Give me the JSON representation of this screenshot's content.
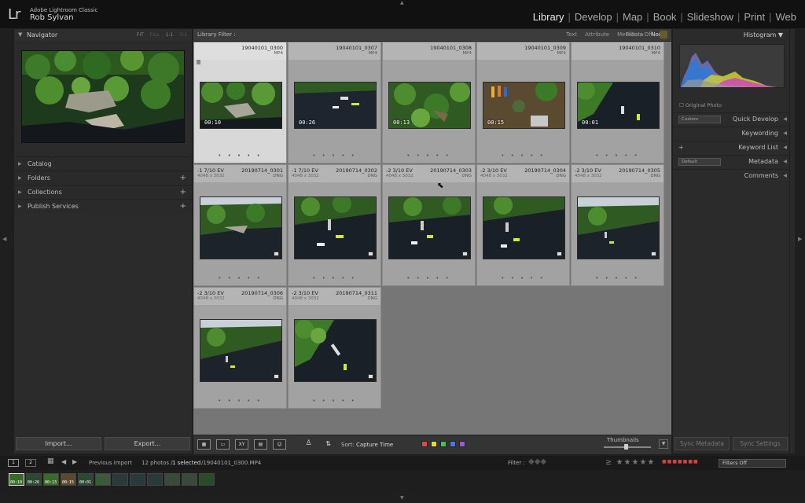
{
  "app": {
    "logo": "Lr",
    "name": "Adobe Lightroom Classic",
    "user": "Rob Sylvan"
  },
  "modules": [
    "Library",
    "Develop",
    "Map",
    "Book",
    "Slideshow",
    "Print",
    "Web"
  ],
  "left_panel": {
    "navigator_title": "Navigator",
    "zoom_fit": "FIT",
    "zoom_fill": "FILL",
    "zoom_1": "1:1",
    "zoom_3": "3:1",
    "sections": [
      "Catalog",
      "Folders",
      "Collections",
      "Publish Services"
    ],
    "import_label": "Import...",
    "export_label": "Export..."
  },
  "filter_bar": {
    "title": "Library Filter :",
    "tabs": [
      "Text",
      "Attribute",
      "Metadata",
      "None"
    ],
    "filters_off": "Filters Off"
  },
  "grid": [
    {
      "name": "19040101_0300",
      "ext": "MP4",
      "duration": "00:10",
      "selected": true
    },
    {
      "name": "19040101_0307",
      "ext": "MP4",
      "duration": "00:26"
    },
    {
      "name": "19040101_0308",
      "ext": "MP4",
      "duration": "00:13"
    },
    {
      "name": "19040101_0309",
      "ext": "MP4",
      "duration": "00:15"
    },
    {
      "name": "19040101_0310",
      "ext": "MP4",
      "duration": "00:01"
    },
    {
      "ev": "-1 7/10 EV",
      "name": "20190714_0301",
      "dims": "4048 x 3032",
      "ext": "DNG"
    },
    {
      "ev": "-1 7/10 EV",
      "name": "20190714_0302",
      "dims": "4048 x 3032",
      "ext": "DNG"
    },
    {
      "ev": "-2 3/10 EV",
      "name": "20190714_0303",
      "dims": "4048 x 3032",
      "ext": "DNG"
    },
    {
      "ev": "-2 3/10 EV",
      "name": "20190714_0304",
      "dims": "4048 x 3032",
      "ext": "DNG"
    },
    {
      "ev": "-2 3/10 EV",
      "name": "20190714_0305",
      "dims": "4048 x 3032",
      "ext": "DNG"
    },
    {
      "ev": "-2 3/10 EV",
      "name": "20190714_0306",
      "dims": "4048 x 3032",
      "ext": "DNG"
    },
    {
      "ev": "-2 3/10 EV",
      "name": "20190714_0311",
      "dims": "4048 x 3032",
      "ext": "DNG"
    }
  ],
  "toolbar": {
    "sort_label": "Sort:",
    "sort_value": "Capture Time",
    "thumbnails_label": "Thumbnails",
    "color_labels": [
      "#e04848",
      "#e8d83a",
      "#4cc04c",
      "#4a7ae0",
      "#9a5ad8"
    ]
  },
  "right_panel": {
    "histogram_title": "Histogram",
    "original_photo": "Original Photo",
    "quick_develop": "Quick Develop",
    "custom": "Custom",
    "keywording": "Keywording",
    "keyword_list": "Keyword List",
    "metadata": "Metadata",
    "default": "Default",
    "comments": "Comments",
    "sync_metadata": "Sync Metadata",
    "sync_settings": "Sync Settings"
  },
  "filmstrip": {
    "page1": "1",
    "page2": "2",
    "source": "Previous Import",
    "status_count": "12 photos /",
    "status_selected": "1 selected",
    "status_file": "/19040101_0300.MP4",
    "filter_label": "Filter :",
    "filters_off": "Filters Off",
    "durations": [
      "00:10",
      "00:26",
      "00:13",
      "00:15",
      "00:01"
    ]
  }
}
